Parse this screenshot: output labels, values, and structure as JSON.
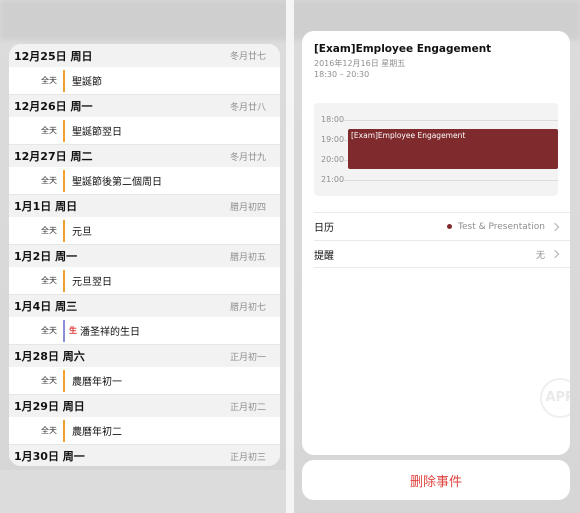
{
  "left": {
    "days": [
      {
        "date": "12月25日 周日",
        "lunar": "冬月廿七",
        "allday": "全天",
        "title": "聖誕節",
        "bar": "orange"
      },
      {
        "date": "12月26日 周一",
        "lunar": "冬月廿八",
        "allday": "全天",
        "title": "聖誕節翌日",
        "bar": "orange"
      },
      {
        "date": "12月27日 周二",
        "lunar": "冬月廿九",
        "allday": "全天",
        "title": "聖誕節後第二個周日",
        "bar": "orange"
      },
      {
        "date": "1月1日 周日",
        "lunar": "腊月初四",
        "allday": "全天",
        "title": "元旦",
        "bar": "orange"
      },
      {
        "date": "1月2日 周一",
        "lunar": "腊月初五",
        "allday": "全天",
        "title": "元旦翌日",
        "bar": "orange"
      },
      {
        "date": "1月4日 周三",
        "lunar": "腊月初七",
        "allday": "全天",
        "title": "潘圣祥的生日",
        "bar": "purple",
        "badge": "生"
      },
      {
        "date": "1月28日 周六",
        "lunar": "正月初一",
        "allday": "全天",
        "title": "農曆年初一",
        "bar": "orange"
      },
      {
        "date": "1月29日 周日",
        "lunar": "正月初二",
        "allday": "全天",
        "title": "農曆年初二",
        "bar": "orange"
      },
      {
        "date": "1月30日 周一",
        "lunar": "正月初三"
      }
    ]
  },
  "right": {
    "event_title": "[Exam]Employee Engagement",
    "event_date": "2016年12月16日 星期五",
    "event_time": "18:30 – 20:30",
    "timeline_hours": [
      "18:00",
      "19:00",
      "20:00",
      "21:00"
    ],
    "timeline_event": "[Exam]Employee Engagement",
    "calendar_label": "日历",
    "calendar_value": "Test & Presentation",
    "alert_label": "提醒",
    "alert_value": "无",
    "accent_color": "#7f2a2d"
  },
  "delete_label": "删除事件",
  "watermark": "APP"
}
